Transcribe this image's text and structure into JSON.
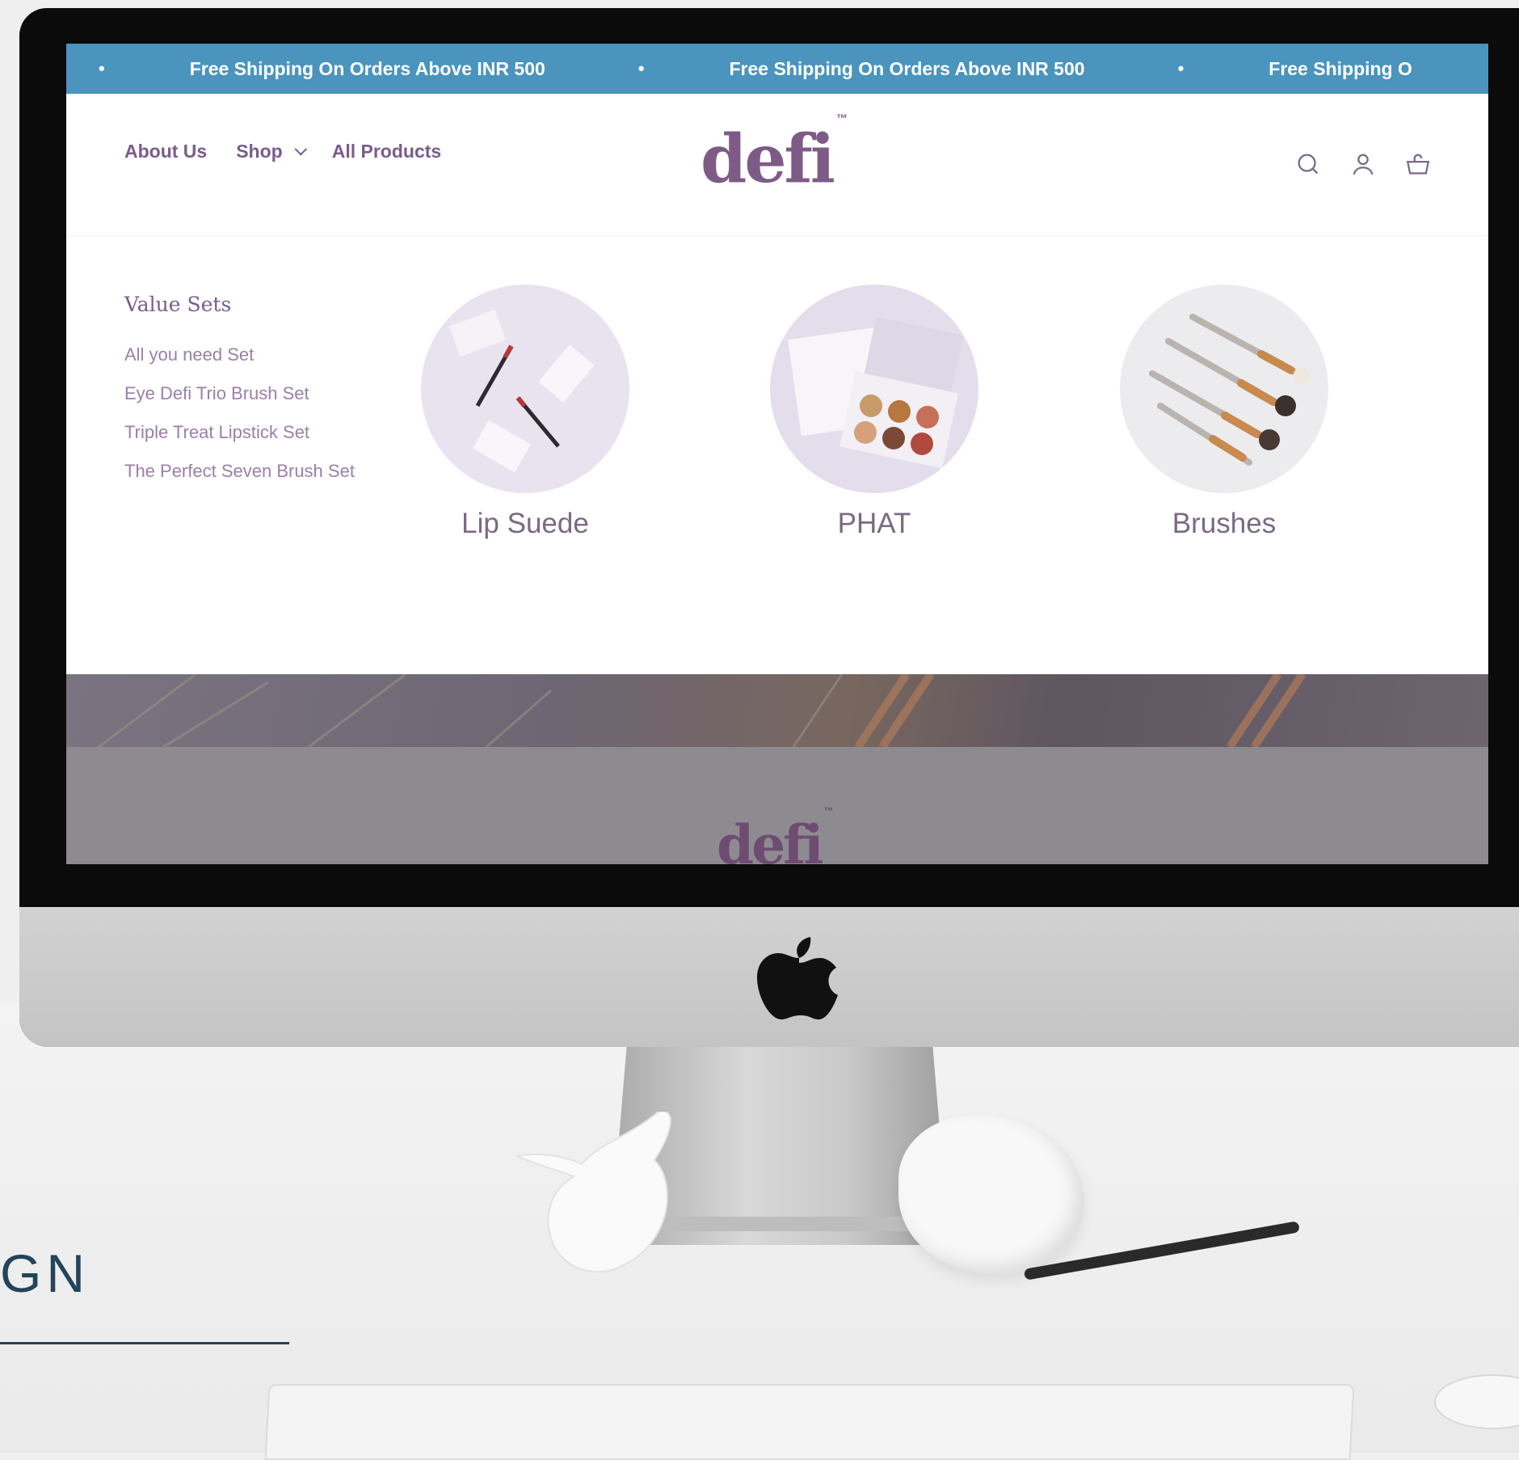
{
  "announcement": {
    "messages": [
      "Free Shipping On Orders Above INR 500",
      "Free Shipping On Orders Above INR 500",
      "Free Shipping O"
    ],
    "separator": "•"
  },
  "header": {
    "nav": [
      "About Us",
      "Shop",
      "All Products"
    ],
    "logo_text": "defi",
    "logo_mark": "™",
    "icons": [
      "search-icon",
      "account-icon",
      "cart-icon"
    ]
  },
  "mega_menu": {
    "value_sets_title": "Value Sets",
    "value_sets": [
      "All you need Set",
      "Eye Defi Trio Brush Set",
      "Triple Treat Lipstick Set",
      "The Perfect Seven Brush Set"
    ],
    "categories": [
      "Lip Suede",
      "PHAT",
      "Brushes"
    ]
  },
  "page_below": {
    "logo_text": "defi",
    "logo_mark": "™"
  },
  "side_caption": "GN",
  "colors": {
    "announcement_bg": "#4a94be",
    "brand_purple": "#7e5b87",
    "caption_navy": "#23445a"
  }
}
